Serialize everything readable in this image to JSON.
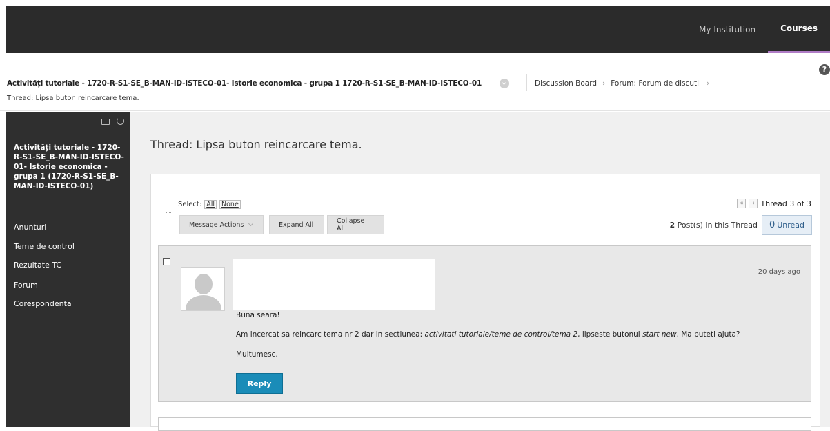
{
  "topnav": {
    "items": [
      {
        "label": "My Institution",
        "active": false
      },
      {
        "label": "Courses",
        "active": true
      }
    ]
  },
  "breadcrumb": {
    "course": "Activități tutoriale - 1720-R-S1-SE_B-MAN-ID-ISTECO-01- Istorie economica - grupa 1 1720-R-S1-SE_B-MAN-ID-ISTECO-01",
    "items": [
      "Discussion Board",
      "Forum: Forum de discutii"
    ],
    "current": "Thread: Lipsa buton reincarcare tema."
  },
  "help_icon": "question-icon",
  "sidebar": {
    "course_title": "Activități tutoriale - 1720-R-S1-SE_B-MAN-ID-ISTECO-01- Istorie economica - grupa 1 (1720-R-S1-SE_B-MAN-ID-ISTECO-01)",
    "items": [
      "Anunturi",
      "Teme de control",
      "Rezultate TC",
      "Forum",
      "Corespondenta"
    ]
  },
  "page": {
    "title": "Thread: Lipsa buton reincarcare tema."
  },
  "toolbar": {
    "select_label": "Select:",
    "select_all": "All",
    "select_none": "None",
    "message_actions": "Message Actions",
    "expand_all": "Expand All",
    "collapse_all": "Collapse All"
  },
  "pager": {
    "first": "«",
    "prev": "‹",
    "label": "Thread 3 of 3"
  },
  "thread_stats": {
    "post_count": "2",
    "post_count_label": "Post(s) in this Thread",
    "unread_count": "0",
    "unread_label": "Unread"
  },
  "post": {
    "date": "20 days ago",
    "greeting": "Buna seara!",
    "body_1": "Am incercat sa reincarc tema nr 2 dar in sectiunea: ",
    "body_path": "activitati tutoriale/teme de control/tema 2",
    "body_2": ", lipseste butonul ",
    "body_button": "start new",
    "body_3": ". Ma puteti ajuta?",
    "closing": "Multumesc.",
    "reply_label": "Reply"
  },
  "colors": {
    "topbar": "#2b2b2b",
    "active_underline": "#b07cc6",
    "sidebar": "#2f2f2f",
    "reply": "#1a8cb8"
  }
}
